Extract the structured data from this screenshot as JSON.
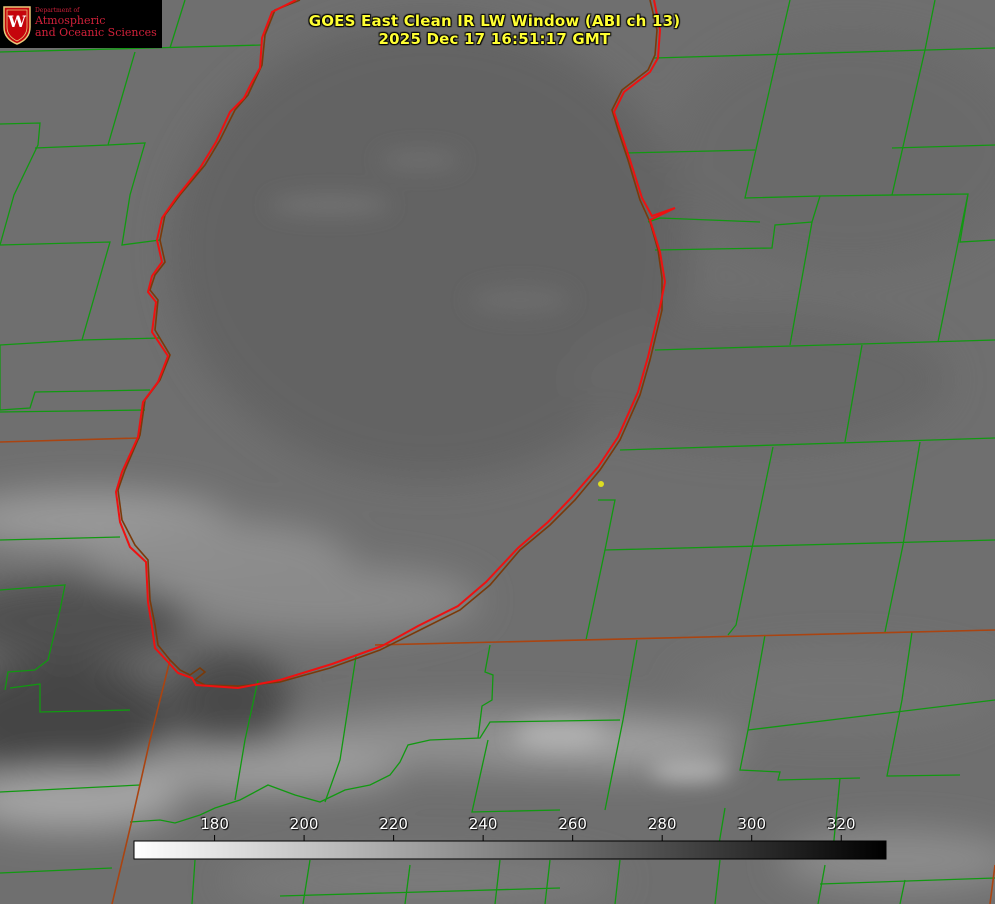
{
  "title_line1": "GOES East Clean IR LW Window (ABI ch 13)",
  "title_line2": "2025 Dec 17 16:51:17 GMT",
  "logo": {
    "dept": "Department of",
    "line1": "Atmospheric",
    "line2": "and Oceanic Sciences",
    "seal_letter": "W",
    "color": "#c5050c"
  },
  "colorbar": {
    "ticks": [
      "180",
      "200",
      "220",
      "240",
      "260",
      "280",
      "300",
      "320"
    ],
    "tick_values": [
      180,
      200,
      220,
      240,
      260,
      280,
      300,
      320
    ],
    "min": 162,
    "max": 330,
    "gradient": "white to black"
  },
  "colors": {
    "title": "#ffff33",
    "county_lines": "#11aa11",
    "state_lines": "#aa4411",
    "coastline": "#ee1111",
    "marker": "#dddd22"
  }
}
